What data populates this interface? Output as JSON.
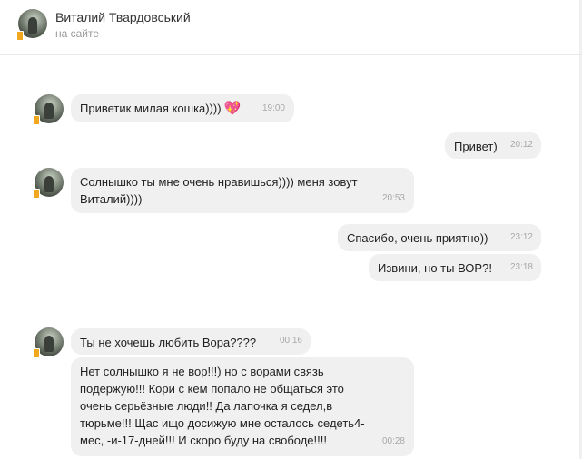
{
  "contact": {
    "name": "Виталий Твардовський",
    "status": "на сайте"
  },
  "messages": [
    {
      "side": "in",
      "text": "Приветик милая кошка))))",
      "emoji": "heart-sparkle",
      "time": "19:00"
    },
    {
      "side": "out",
      "text": "Привет)",
      "time": "20:12"
    },
    {
      "side": "in",
      "text": "Солнышко ты мне очень нравишься))))  меня зовут\nВиталий))))",
      "time": "20:53"
    },
    {
      "side": "out",
      "text": "Спасибо, очень приятно))",
      "time": "23:12"
    },
    {
      "side": "out",
      "text": "Извини, но ты ВОР?!",
      "time": "23:18"
    },
    {
      "side": "in",
      "text": "Ты не хочешь любить Вора????",
      "time": "00:16"
    },
    {
      "side": "in",
      "text": "Нет солнышко я не вор!!!) но с ворами связь\nподержую!!! Кори с кем попало не общаться это\nочень серьёзные люди!!  Да лапочка я седел,в\nтюрьме!!!  Щас  ищо досижую мне осталось седеть4-\nмес, -и-17-дней!!! И скоро буду на свободе!!!!",
      "time": "00:28"
    }
  ],
  "colors": {
    "bubble": "#f0f0f0",
    "time": "#a8a8a8",
    "status": "#9a9a9a",
    "online_badge": "#f2a81e"
  }
}
